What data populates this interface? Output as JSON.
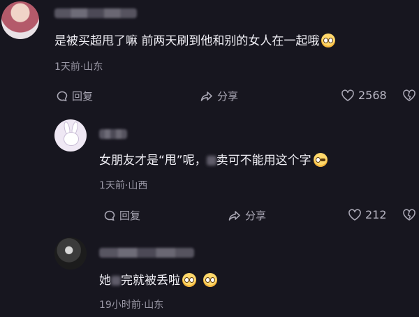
{
  "comments": [
    {
      "text": "是被买超甩了嘛 前两天刷到他和别的女人在一起哦",
      "meta": "1天前·山东",
      "reply_label": "回复",
      "share_label": "分享",
      "like_count": "2568",
      "emoji": "flushed-face"
    },
    {
      "text_before": "女朋友才是“甩”呢，",
      "text_after": "卖可不能用这个字",
      "meta": "1天前·山西",
      "reply_label": "回复",
      "share_label": "分享",
      "like_count": "212",
      "emoji": "winking-tongue-face"
    },
    {
      "text_before": "她",
      "text_after": "完就被丢啦",
      "meta": "19小时前·山东",
      "emoji": "flushed-face"
    }
  ]
}
